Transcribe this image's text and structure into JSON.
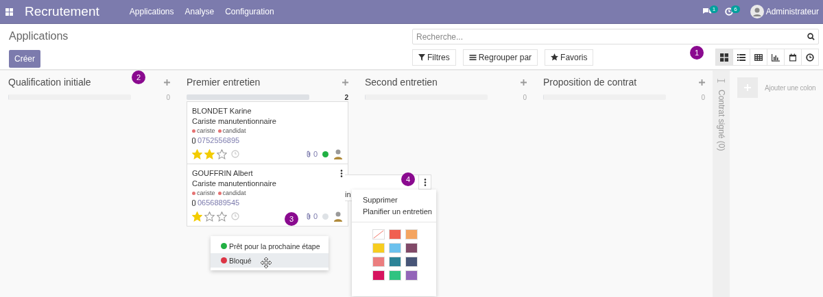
{
  "navbar": {
    "app_title": "Recrutement",
    "menu": [
      "Applications",
      "Analyse",
      "Configuration"
    ],
    "messages_count": "1",
    "activities_count": "6",
    "user": "Administrateur"
  },
  "control_panel": {
    "breadcrumb": "Applications",
    "create_button": "Créer",
    "search": {
      "placeholder": "Recherche..."
    },
    "filter_buttons": [
      "Filtres",
      "Regrouper par",
      "Favoris"
    ],
    "view_switcher": [
      {
        "selected": true
      },
      {
        "selected": false
      },
      {
        "selected": false
      },
      {
        "selected": false
      },
      {
        "selected": false
      },
      {
        "selected": false
      }
    ]
  },
  "columns": [
    {
      "title": "Qualification initiale",
      "count": "0",
      "level": 0
    },
    {
      "title": "Premier entretien",
      "count": "2",
      "level": 1,
      "cards": [
        {
          "name": "BLONDET Karine",
          "job": "Cariste manutentionnaire",
          "tags": [
            {
              "label": "cariste",
              "color": "#e57373"
            },
            {
              "label": "candidat",
              "color": "#e57373"
            }
          ],
          "phone": "0752556895",
          "stars": 2,
          "attachments": "0",
          "ready": true,
          "menu_button": false
        },
        {
          "name": "GOUFFRIN Albert",
          "job": "Cariste manutentionnaire",
          "tags": [
            {
              "label": "cariste",
              "color": "#e57373"
            },
            {
              "label": "candidat",
              "color": "#e57373"
            }
          ],
          "phone": "0656889545",
          "stars": 1,
          "attachments": "0",
          "ready": false,
          "menu_button": true
        }
      ]
    },
    {
      "title": "Second entretien",
      "count": "0",
      "level": 0
    },
    {
      "title": "Proposition de contrat",
      "count": "0",
      "level": 0
    }
  ],
  "folded_column": {
    "title": "Contrat signé (0)"
  },
  "add_column": {
    "label": "Ajouter une colon"
  },
  "ghost_card": {
    "text": "in"
  },
  "state_menu": [
    {
      "label": "Prêt pour la prochaine étape",
      "color": "#21b043",
      "selected": false
    },
    {
      "label": "Bloqué",
      "color": "#dc3545",
      "selected": true
    }
  ],
  "card_menu": {
    "items": [
      "Supprimer",
      "Planifier un entretien"
    ],
    "colors": [
      {
        "kind": "none",
        "color": "#ffffff"
      },
      {
        "kind": "swatch",
        "color": "#f06050"
      },
      {
        "kind": "swatch",
        "color": "#f4a460"
      },
      {
        "kind": "swatch",
        "color": "#f7cd1f"
      },
      {
        "kind": "swatch",
        "color": "#6cc1ed"
      },
      {
        "kind": "swatch",
        "color": "#814968"
      },
      {
        "kind": "swatch",
        "color": "#eb7e7f"
      },
      {
        "kind": "swatch",
        "color": "#2c8397"
      },
      {
        "kind": "swatch",
        "color": "#475577"
      },
      {
        "kind": "swatch",
        "color": "#d6145f"
      },
      {
        "kind": "swatch",
        "color": "#30c381"
      },
      {
        "kind": "swatch",
        "color": "#9365b8"
      }
    ]
  },
  "callouts": [
    "1",
    "2",
    "3",
    "4"
  ]
}
